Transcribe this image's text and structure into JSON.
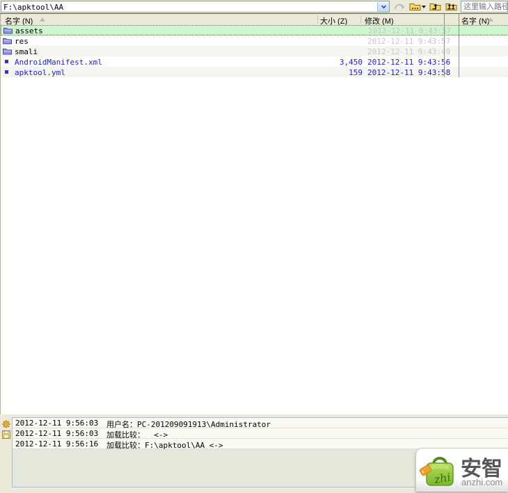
{
  "address_bar": {
    "value": "F:\\apktool\\AA"
  },
  "path_input": {
    "placeholder": "这里输入路径"
  },
  "icons": {
    "combo_dropdown": "chevron-down",
    "swap": "curved-arrow-grayed",
    "browse": "folder-ellipsis",
    "browse_dropdown": "triangle-down",
    "parent": "folder-up-arrow",
    "root": "folder-double-up-arrow",
    "sort": "triangle-up",
    "folder_row": "purple-folder",
    "file_row": "blue-square",
    "log_settings": "gear",
    "log_save": "floppy-disk"
  },
  "left_pane": {
    "header": {
      "name": "名字 (N)",
      "size": "大小 (Z)",
      "modified": "修改 (M)"
    },
    "rows": [
      {
        "name": "assets",
        "size": "",
        "modified": "2012-12-11 9:43:57",
        "type": "folder",
        "selected": true
      },
      {
        "name": "res",
        "size": "",
        "modified": "2012-12-11 9:43:57",
        "type": "folder",
        "selected": false
      },
      {
        "name": "smali",
        "size": "",
        "modified": "2012-12-11 9:43:49",
        "type": "folder",
        "selected": false
      },
      {
        "name": "AndroidManifest.xml",
        "size": "3,450",
        "modified": "2012-12-11 9:43:56",
        "type": "file",
        "selected": false
      },
      {
        "name": "apktool.yml",
        "size": "159",
        "modified": "2012-12-11 9:43:58",
        "type": "file",
        "selected": false
      }
    ]
  },
  "right_pane": {
    "header": {
      "name": "名字 (N)"
    }
  },
  "log": {
    "entries": [
      {
        "time": "2012-12-11 9:56:03",
        "message": "用户名：PC-201209091913\\Administrator"
      },
      {
        "time": "2012-12-11 9:56:03",
        "message": "加载比较：  <->"
      },
      {
        "time": "2012-12-11 9:56:16",
        "message": "加载比较：F:\\apktool\\AA <->"
      }
    ]
  },
  "watermark": {
    "brand": "安智",
    "domain": "anzhi.com",
    "bag_text": "zhi"
  },
  "colors": {
    "xp_beige": "#ECE9D8",
    "selection_green": "#CDF6CE",
    "file_blue": "#1A1AE0",
    "folder_date_gray": "#C6C6C6",
    "combo_border_blue": "#7F9DB9",
    "anzhi_green": "#8DC63F"
  }
}
